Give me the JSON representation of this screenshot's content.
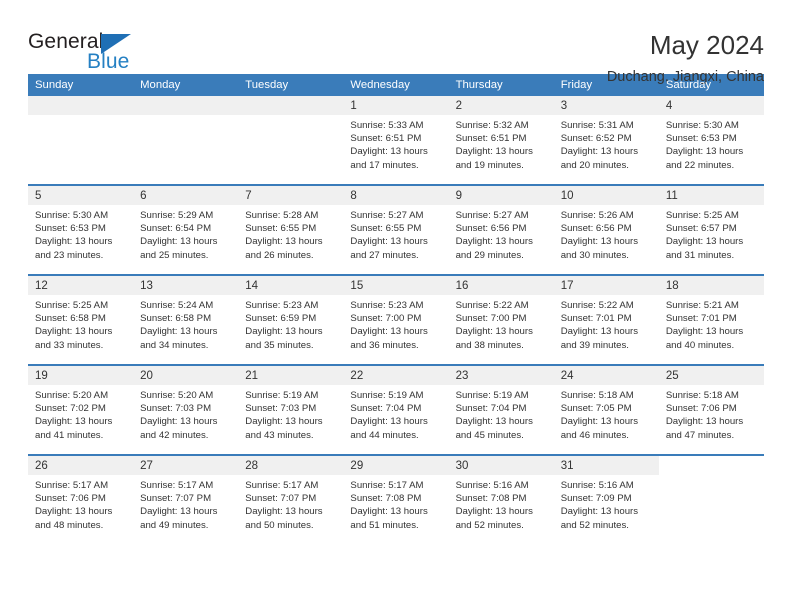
{
  "brand": {
    "name_part1": "General",
    "name_part2": "Blue",
    "triangle_color": "#1f6fb5",
    "blue_text_color": "#2580c3"
  },
  "header": {
    "title": "May 2024",
    "subtitle": "Duchang, Jiangxi, China"
  },
  "theme": {
    "header_blue": "#3a7cba",
    "daynum_band": "#f0f0f0",
    "text": "#333333"
  },
  "weekdays": [
    "Sunday",
    "Monday",
    "Tuesday",
    "Wednesday",
    "Thursday",
    "Friday",
    "Saturday"
  ],
  "labels": {
    "sunrise_prefix": "Sunrise:",
    "sunset_prefix": "Sunset:",
    "daylight_prefix": "Daylight:"
  },
  "weeks": [
    [
      {
        "day": "",
        "empty": true,
        "shaded": true,
        "l1": "",
        "l2": "",
        "l3": "",
        "l4": ""
      },
      {
        "day": "",
        "empty": true,
        "shaded": true,
        "l1": "",
        "l2": "",
        "l3": "",
        "l4": ""
      },
      {
        "day": "",
        "empty": true,
        "shaded": true,
        "l1": "",
        "l2": "",
        "l3": "",
        "l4": ""
      },
      {
        "day": "1",
        "empty": false,
        "shaded": true,
        "l1": "Sunrise: 5:33 AM",
        "l2": "Sunset: 6:51 PM",
        "l3": "Daylight: 13 hours",
        "l4": "and 17 minutes."
      },
      {
        "day": "2",
        "empty": false,
        "shaded": true,
        "l1": "Sunrise: 5:32 AM",
        "l2": "Sunset: 6:51 PM",
        "l3": "Daylight: 13 hours",
        "l4": "and 19 minutes."
      },
      {
        "day": "3",
        "empty": false,
        "shaded": true,
        "l1": "Sunrise: 5:31 AM",
        "l2": "Sunset: 6:52 PM",
        "l3": "Daylight: 13 hours",
        "l4": "and 20 minutes."
      },
      {
        "day": "4",
        "empty": false,
        "shaded": true,
        "l1": "Sunrise: 5:30 AM",
        "l2": "Sunset: 6:53 PM",
        "l3": "Daylight: 13 hours",
        "l4": "and 22 minutes."
      }
    ],
    [
      {
        "day": "5",
        "empty": false,
        "shaded": true,
        "l1": "Sunrise: 5:30 AM",
        "l2": "Sunset: 6:53 PM",
        "l3": "Daylight: 13 hours",
        "l4": "and 23 minutes."
      },
      {
        "day": "6",
        "empty": false,
        "shaded": true,
        "l1": "Sunrise: 5:29 AM",
        "l2": "Sunset: 6:54 PM",
        "l3": "Daylight: 13 hours",
        "l4": "and 25 minutes."
      },
      {
        "day": "7",
        "empty": false,
        "shaded": true,
        "l1": "Sunrise: 5:28 AM",
        "l2": "Sunset: 6:55 PM",
        "l3": "Daylight: 13 hours",
        "l4": "and 26 minutes."
      },
      {
        "day": "8",
        "empty": false,
        "shaded": true,
        "l1": "Sunrise: 5:27 AM",
        "l2": "Sunset: 6:55 PM",
        "l3": "Daylight: 13 hours",
        "l4": "and 27 minutes."
      },
      {
        "day": "9",
        "empty": false,
        "shaded": true,
        "l1": "Sunrise: 5:27 AM",
        "l2": "Sunset: 6:56 PM",
        "l3": "Daylight: 13 hours",
        "l4": "and 29 minutes."
      },
      {
        "day": "10",
        "empty": false,
        "shaded": true,
        "l1": "Sunrise: 5:26 AM",
        "l2": "Sunset: 6:56 PM",
        "l3": "Daylight: 13 hours",
        "l4": "and 30 minutes."
      },
      {
        "day": "11",
        "empty": false,
        "shaded": true,
        "l1": "Sunrise: 5:25 AM",
        "l2": "Sunset: 6:57 PM",
        "l3": "Daylight: 13 hours",
        "l4": "and 31 minutes."
      }
    ],
    [
      {
        "day": "12",
        "empty": false,
        "shaded": true,
        "l1": "Sunrise: 5:25 AM",
        "l2": "Sunset: 6:58 PM",
        "l3": "Daylight: 13 hours",
        "l4": "and 33 minutes."
      },
      {
        "day": "13",
        "empty": false,
        "shaded": true,
        "l1": "Sunrise: 5:24 AM",
        "l2": "Sunset: 6:58 PM",
        "l3": "Daylight: 13 hours",
        "l4": "and 34 minutes."
      },
      {
        "day": "14",
        "empty": false,
        "shaded": true,
        "l1": "Sunrise: 5:23 AM",
        "l2": "Sunset: 6:59 PM",
        "l3": "Daylight: 13 hours",
        "l4": "and 35 minutes."
      },
      {
        "day": "15",
        "empty": false,
        "shaded": true,
        "l1": "Sunrise: 5:23 AM",
        "l2": "Sunset: 7:00 PM",
        "l3": "Daylight: 13 hours",
        "l4": "and 36 minutes."
      },
      {
        "day": "16",
        "empty": false,
        "shaded": true,
        "l1": "Sunrise: 5:22 AM",
        "l2": "Sunset: 7:00 PM",
        "l3": "Daylight: 13 hours",
        "l4": "and 38 minutes."
      },
      {
        "day": "17",
        "empty": false,
        "shaded": true,
        "l1": "Sunrise: 5:22 AM",
        "l2": "Sunset: 7:01 PM",
        "l3": "Daylight: 13 hours",
        "l4": "and 39 minutes."
      },
      {
        "day": "18",
        "empty": false,
        "shaded": true,
        "l1": "Sunrise: 5:21 AM",
        "l2": "Sunset: 7:01 PM",
        "l3": "Daylight: 13 hours",
        "l4": "and 40 minutes."
      }
    ],
    [
      {
        "day": "19",
        "empty": false,
        "shaded": true,
        "l1": "Sunrise: 5:20 AM",
        "l2": "Sunset: 7:02 PM",
        "l3": "Daylight: 13 hours",
        "l4": "and 41 minutes."
      },
      {
        "day": "20",
        "empty": false,
        "shaded": true,
        "l1": "Sunrise: 5:20 AM",
        "l2": "Sunset: 7:03 PM",
        "l3": "Daylight: 13 hours",
        "l4": "and 42 minutes."
      },
      {
        "day": "21",
        "empty": false,
        "shaded": true,
        "l1": "Sunrise: 5:19 AM",
        "l2": "Sunset: 7:03 PM",
        "l3": "Daylight: 13 hours",
        "l4": "and 43 minutes."
      },
      {
        "day": "22",
        "empty": false,
        "shaded": true,
        "l1": "Sunrise: 5:19 AM",
        "l2": "Sunset: 7:04 PM",
        "l3": "Daylight: 13 hours",
        "l4": "and 44 minutes."
      },
      {
        "day": "23",
        "empty": false,
        "shaded": true,
        "l1": "Sunrise: 5:19 AM",
        "l2": "Sunset: 7:04 PM",
        "l3": "Daylight: 13 hours",
        "l4": "and 45 minutes."
      },
      {
        "day": "24",
        "empty": false,
        "shaded": true,
        "l1": "Sunrise: 5:18 AM",
        "l2": "Sunset: 7:05 PM",
        "l3": "Daylight: 13 hours",
        "l4": "and 46 minutes."
      },
      {
        "day": "25",
        "empty": false,
        "shaded": true,
        "l1": "Sunrise: 5:18 AM",
        "l2": "Sunset: 7:06 PM",
        "l3": "Daylight: 13 hours",
        "l4": "and 47 minutes."
      }
    ],
    [
      {
        "day": "26",
        "empty": false,
        "shaded": true,
        "l1": "Sunrise: 5:17 AM",
        "l2": "Sunset: 7:06 PM",
        "l3": "Daylight: 13 hours",
        "l4": "and 48 minutes."
      },
      {
        "day": "27",
        "empty": false,
        "shaded": true,
        "l1": "Sunrise: 5:17 AM",
        "l2": "Sunset: 7:07 PM",
        "l3": "Daylight: 13 hours",
        "l4": "and 49 minutes."
      },
      {
        "day": "28",
        "empty": false,
        "shaded": true,
        "l1": "Sunrise: 5:17 AM",
        "l2": "Sunset: 7:07 PM",
        "l3": "Daylight: 13 hours",
        "l4": "and 50 minutes."
      },
      {
        "day": "29",
        "empty": false,
        "shaded": true,
        "l1": "Sunrise: 5:17 AM",
        "l2": "Sunset: 7:08 PM",
        "l3": "Daylight: 13 hours",
        "l4": "and 51 minutes."
      },
      {
        "day": "30",
        "empty": false,
        "shaded": true,
        "l1": "Sunrise: 5:16 AM",
        "l2": "Sunset: 7:08 PM",
        "l3": "Daylight: 13 hours",
        "l4": "and 52 minutes."
      },
      {
        "day": "31",
        "empty": false,
        "shaded": true,
        "l1": "Sunrise: 5:16 AM",
        "l2": "Sunset: 7:09 PM",
        "l3": "Daylight: 13 hours",
        "l4": "and 52 minutes."
      },
      {
        "day": "",
        "empty": true,
        "shaded": false,
        "l1": "",
        "l2": "",
        "l3": "",
        "l4": ""
      }
    ]
  ]
}
